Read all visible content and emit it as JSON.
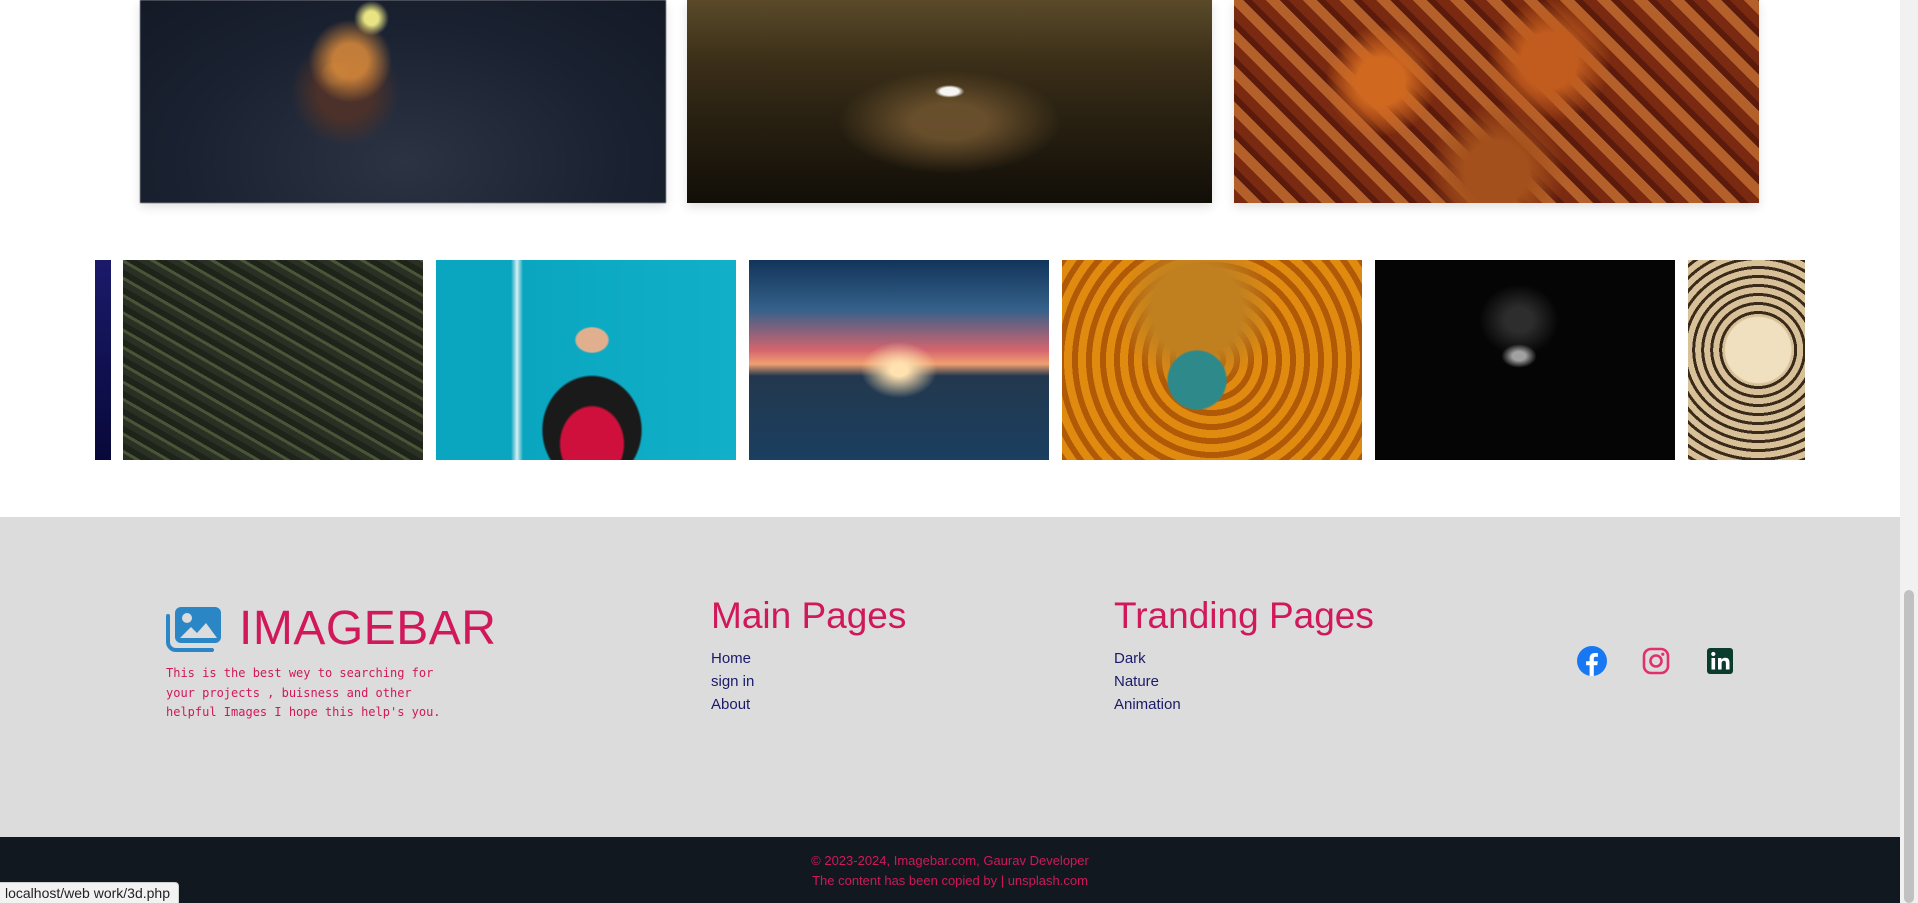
{
  "gallery": {
    "top_images": [
      "3d-render-blocks",
      "bunny-figure-reflection",
      "durga-idol"
    ],
    "carousel_images": [
      "blue-edge",
      "pine-branches",
      "man-blue-wall",
      "lake-sunset-pier",
      "krishna-painting",
      "dark-tunnel-light",
      "leopard"
    ]
  },
  "footer": {
    "brand": {
      "title": "IMAGEBAR",
      "icon": "images-icon",
      "description": "This is the best wey to searching for\n your projects , buisness and other\nhelpful Images I hope this help's you."
    },
    "main_pages": {
      "title": "Main Pages",
      "links": [
        "Home",
        "sign in",
        "About"
      ]
    },
    "trending_pages": {
      "title": "Tranding Pages",
      "links": [
        "Dark",
        "Nature",
        "Animation"
      ]
    },
    "social": [
      {
        "name": "facebook-icon",
        "color": "#1877f2"
      },
      {
        "name": "instagram-icon",
        "color": "#e1306c"
      },
      {
        "name": "linkedin-icon",
        "color": "#0b3d2e"
      }
    ],
    "copyright_line1": "© 2023-2024, Imagebar.com, Gaurav Developer",
    "copyright_line2": "The content has been copied by | unsplash.com"
  },
  "status_bar": {
    "url": "localhost/web work/3d.php"
  },
  "colors": {
    "accent": "#d0185a",
    "link": "#1a1a6a",
    "footer_bg": "#dcdcdc",
    "bottom_bar": "#111820"
  }
}
